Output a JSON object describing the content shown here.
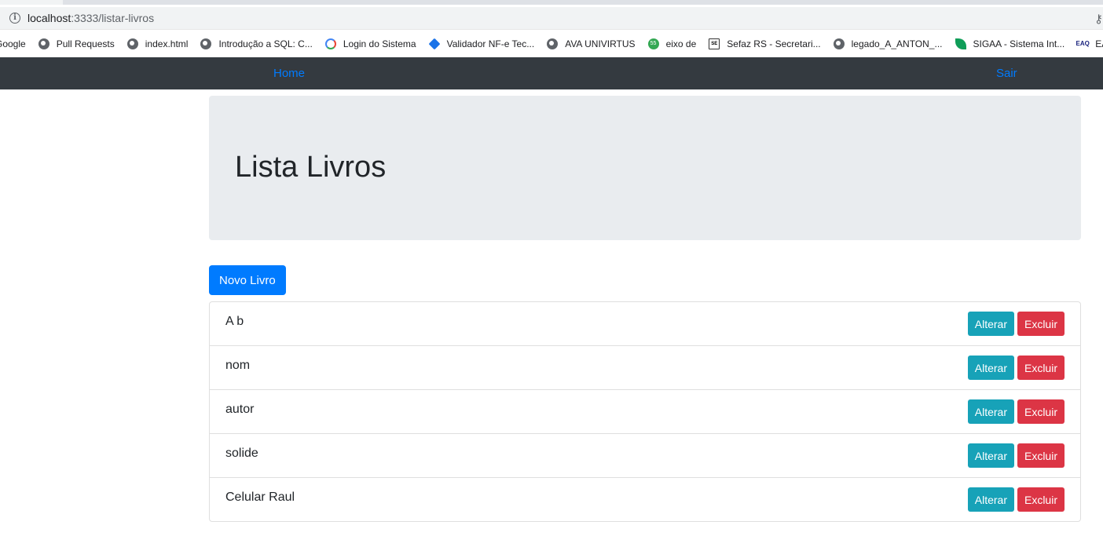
{
  "browser": {
    "url_host": "localhost",
    "url_path": ":3333/listar-livros",
    "bookmarks": [
      {
        "label": "Google",
        "icon": "google-icon"
      },
      {
        "label": "Pull Requests",
        "icon": "globe-icon"
      },
      {
        "label": "index.html",
        "icon": "globe-icon"
      },
      {
        "label": "Introdução a SQL: C...",
        "icon": "globe-icon"
      },
      {
        "label": "Login do Sistema",
        "icon": "google-icon"
      },
      {
        "label": "Validador NF-e Tec...",
        "icon": "diamond-icon"
      },
      {
        "label": "AVA UNIVIRTUS",
        "icon": "globe-icon"
      },
      {
        "label": "eixo de",
        "icon": "badge-55-icon"
      },
      {
        "label": "Sefaz RS - Secretari...",
        "icon": "sefaz-icon"
      },
      {
        "label": "legado_A_ANTON_...",
        "icon": "globe-icon"
      },
      {
        "label": "SIGAA - Sistema Int...",
        "icon": "leaf-icon"
      },
      {
        "label": "EAQ",
        "icon": "eaq-icon"
      }
    ]
  },
  "navbar": {
    "home": "Home",
    "logout": "Sair",
    "background": "#343a40",
    "link_color": "#007bff"
  },
  "page": {
    "title": "Lista Livros",
    "new_button": "Novo Livro"
  },
  "books": [
    {
      "title": "A b",
      "edit": "Alterar",
      "delete": "Excluir"
    },
    {
      "title": "nom",
      "edit": "Alterar",
      "delete": "Excluir"
    },
    {
      "title": "autor",
      "edit": "Alterar",
      "delete": "Excluir"
    },
    {
      "title": "solide",
      "edit": "Alterar",
      "delete": "Excluir"
    },
    {
      "title": "Celular Raul",
      "edit": "Alterar",
      "delete": "Excluir"
    }
  ],
  "colors": {
    "primary": "#007bff",
    "info": "#17a2b8",
    "danger": "#dc3545",
    "jumbotron": "#e9ecef"
  }
}
